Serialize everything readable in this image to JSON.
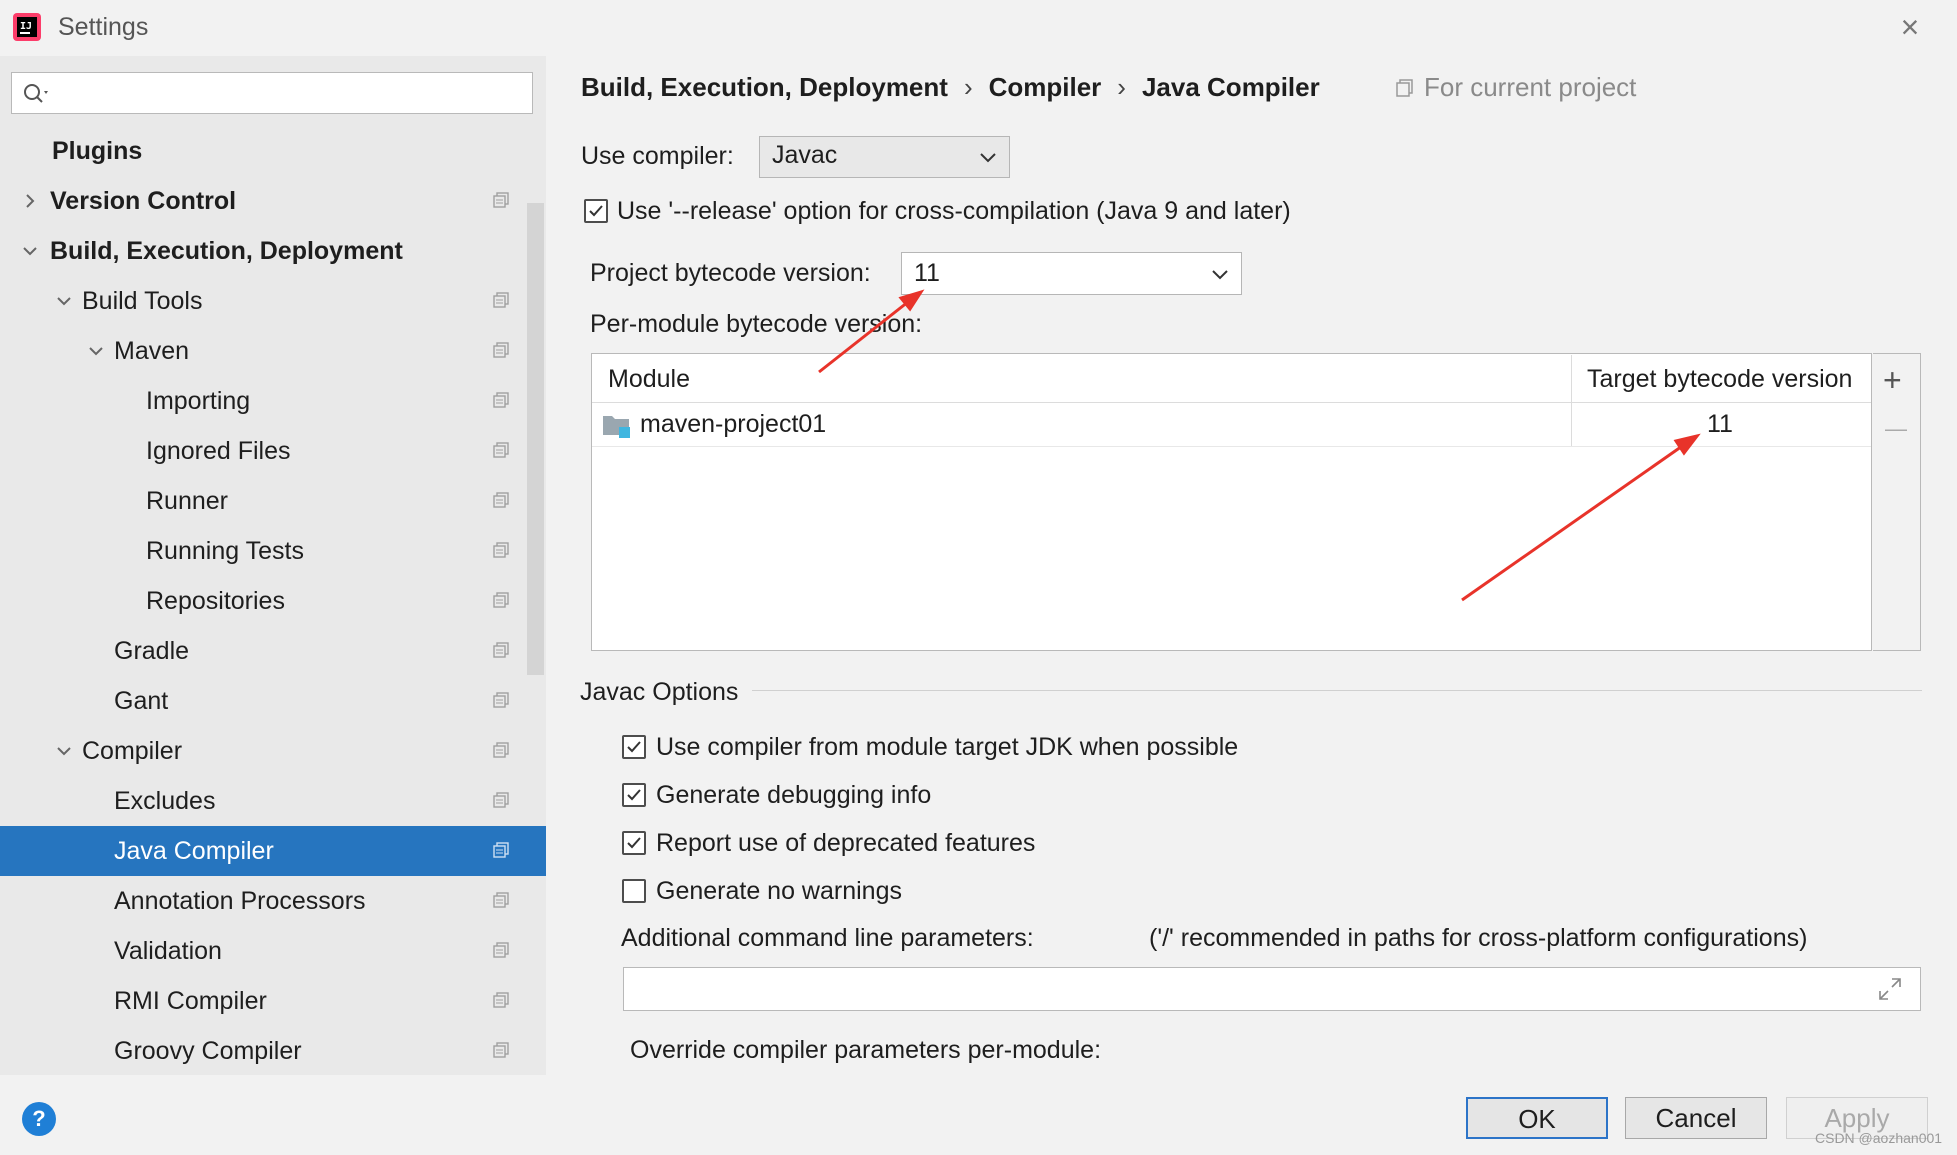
{
  "window": {
    "title": "Settings"
  },
  "sidebar": {
    "search_placeholder": "",
    "items": [
      {
        "label": "Plugins"
      },
      {
        "label": "Version Control"
      },
      {
        "label": "Build, Execution, Deployment"
      },
      {
        "label": "Build Tools"
      },
      {
        "label": "Maven"
      },
      {
        "label": "Importing"
      },
      {
        "label": "Ignored Files"
      },
      {
        "label": "Runner"
      },
      {
        "label": "Running Tests"
      },
      {
        "label": "Repositories"
      },
      {
        "label": "Gradle"
      },
      {
        "label": "Gant"
      },
      {
        "label": "Compiler"
      },
      {
        "label": "Excludes"
      },
      {
        "label": "Java Compiler"
      },
      {
        "label": "Annotation Processors"
      },
      {
        "label": "Validation"
      },
      {
        "label": "RMI Compiler"
      },
      {
        "label": "Groovy Compiler"
      }
    ],
    "selected": "Java Compiler",
    "help_label": "?"
  },
  "breadcrumb": {
    "items": [
      "Build, Execution, Deployment",
      "Compiler",
      "Java Compiler"
    ],
    "separator": "›",
    "scope": "For current project"
  },
  "compiler": {
    "use_compiler_label": "Use compiler:",
    "use_compiler_value": "Javac",
    "release_option": {
      "label": "Use '--release' option for cross-compilation (Java 9 and later)",
      "checked": true
    },
    "project_bytecode_label": "Project bytecode version:",
    "project_bytecode_value": "11",
    "per_module_label": "Per-module bytecode version:"
  },
  "module_table": {
    "columns": [
      "Module",
      "Target bytecode version"
    ],
    "rows": [
      {
        "module": "maven-project01",
        "version": "11"
      }
    ],
    "add_label": "+",
    "remove_label": "—"
  },
  "javac_options": {
    "title": "Javac Options",
    "checkboxes": [
      {
        "label": "Use compiler from module target JDK when possible",
        "checked": true
      },
      {
        "label": "Generate debugging info",
        "checked": true
      },
      {
        "label": "Report use of deprecated features",
        "checked": true
      },
      {
        "label": "Generate no warnings",
        "checked": false
      }
    ],
    "params_label": "Additional command line parameters:",
    "params_hint": "('/' recommended in paths for cross-platform configurations)",
    "params_value": "",
    "override_label": "Override compiler parameters per-module:"
  },
  "buttons": {
    "ok": "OK",
    "cancel": "Cancel",
    "apply": "Apply"
  },
  "watermark": "CSDN @aozhan001",
  "colors": {
    "selection": "#2675bf",
    "annotation_arrow": "#e8332a",
    "ok_border": "#2c74c8"
  }
}
